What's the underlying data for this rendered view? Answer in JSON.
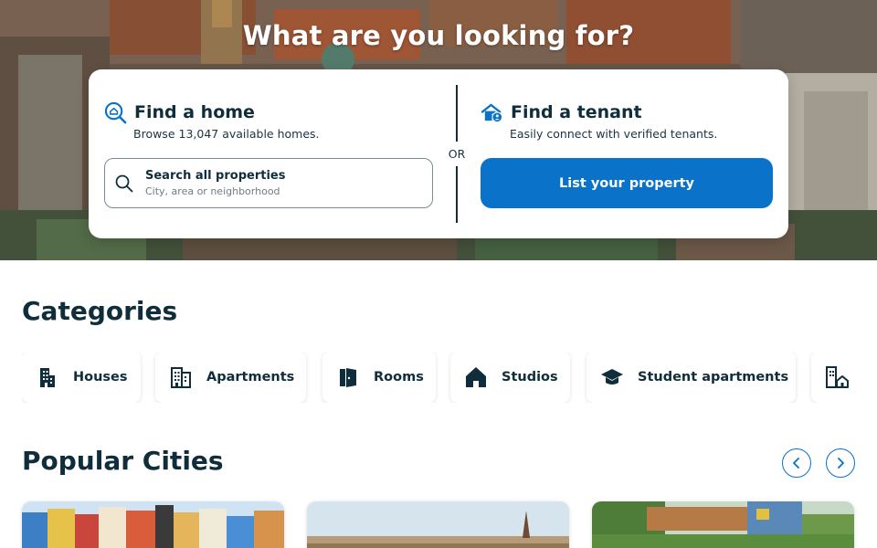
{
  "hero": {
    "title": "What are you looking for?",
    "find_home": {
      "heading": "Find a home",
      "subtitle": "Browse 13,047 available homes.",
      "icon": "home-search-icon"
    },
    "search": {
      "label": "Search all properties",
      "placeholder": "City, area or neighborhood",
      "icon": "search-icon"
    },
    "or_label": "OR",
    "find_tenant": {
      "heading": "Find a tenant",
      "subtitle": "Easily connect with verified tenants.",
      "icon": "home-user-icon"
    },
    "list_button": "List your property"
  },
  "categories": {
    "title": "Categories",
    "items": [
      {
        "label": "Houses",
        "icon": "building-icon"
      },
      {
        "label": "Apartments",
        "icon": "apartment-building-icon"
      },
      {
        "label": "Rooms",
        "icon": "door-icon"
      },
      {
        "label": "Studios",
        "icon": "house-icon"
      },
      {
        "label": "Student apartments",
        "icon": "graduation-cap-icon"
      },
      {
        "label": "",
        "icon": "building-house-icon"
      }
    ]
  },
  "popular_cities": {
    "title": "Popular Cities",
    "prev_icon": "chevron-left-icon",
    "next_icon": "chevron-right-icon",
    "cards": [
      {
        "image": "city-photo-colorful-harbor"
      },
      {
        "image": "city-photo-skyline-spire"
      },
      {
        "image": "city-photo-green-park"
      }
    ]
  },
  "colors": {
    "primary": "#0a72c8",
    "text": "#0f2d3a",
    "muted": "#6f7c84"
  }
}
